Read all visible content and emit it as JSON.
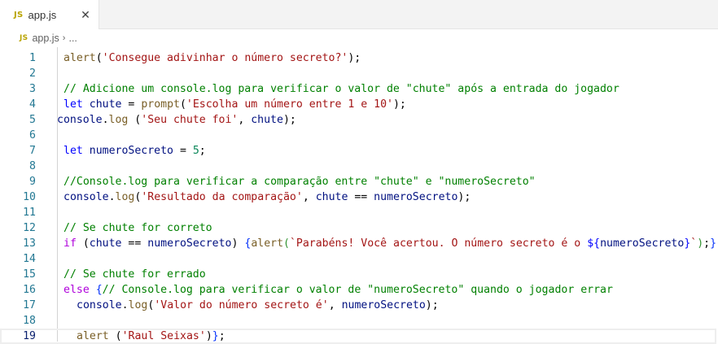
{
  "tab": {
    "badge": "JS",
    "title": "app.js",
    "close_icon": "close-icon"
  },
  "breadcrumb": {
    "badge": "JS",
    "file": "app.js",
    "chevron": "›",
    "ellipsis": "..."
  },
  "colors": {
    "line_number": "#237893",
    "keyword": "#0000ff",
    "control": "#af00db",
    "function": "#795e26",
    "variable": "#001080",
    "string": "#a31515",
    "number": "#098658",
    "comment": "#008000"
  },
  "editor": {
    "current_line": 19,
    "lines": [
      {
        "n": "1",
        "indent": 1,
        "tokens": [
          [
            "fn",
            "alert"
          ],
          [
            "plain",
            "("
          ],
          [
            "str",
            "'Consegue adivinhar o número secreto?'"
          ],
          [
            "plain",
            ");"
          ]
        ]
      },
      {
        "n": "2",
        "indent": 1,
        "tokens": []
      },
      {
        "n": "3",
        "indent": 1,
        "tokens": [
          [
            "cmt",
            "// Adicione um console.log para verificar o valor de \"chute\" após a entrada do jogador"
          ]
        ]
      },
      {
        "n": "4",
        "indent": 1,
        "tokens": [
          [
            "kw",
            "let"
          ],
          [
            "plain",
            " "
          ],
          [
            "var",
            "chute"
          ],
          [
            "plain",
            " = "
          ],
          [
            "fn",
            "prompt"
          ],
          [
            "plain",
            "("
          ],
          [
            "str",
            "'Escolha um número entre 1 e 10'"
          ],
          [
            "plain",
            ");"
          ]
        ]
      },
      {
        "n": "5",
        "indent": 0,
        "tokens": [
          [
            "var",
            "console"
          ],
          [
            "plain",
            "."
          ],
          [
            "fn",
            "log"
          ],
          [
            "plain",
            " ("
          ],
          [
            "str",
            "'Seu chute foi'"
          ],
          [
            "plain",
            ", "
          ],
          [
            "var",
            "chute"
          ],
          [
            "plain",
            ");"
          ]
        ]
      },
      {
        "n": "6",
        "indent": 1,
        "tokens": []
      },
      {
        "n": "7",
        "indent": 1,
        "tokens": [
          [
            "kw",
            "let"
          ],
          [
            "plain",
            " "
          ],
          [
            "var",
            "numeroSecreto"
          ],
          [
            "plain",
            " = "
          ],
          [
            "num",
            "5"
          ],
          [
            "plain",
            ";"
          ]
        ]
      },
      {
        "n": "8",
        "indent": 1,
        "tokens": []
      },
      {
        "n": "9",
        "indent": 1,
        "tokens": [
          [
            "cmt",
            "//Console.log para verificar a comparação entre \"chute\" e \"numeroSecreto\""
          ]
        ]
      },
      {
        "n": "10",
        "indent": 1,
        "tokens": [
          [
            "var",
            "console"
          ],
          [
            "plain",
            "."
          ],
          [
            "fn",
            "log"
          ],
          [
            "plain",
            "("
          ],
          [
            "str",
            "'Resultado da comparação'"
          ],
          [
            "plain",
            ", "
          ],
          [
            "var",
            "chute"
          ],
          [
            "plain",
            " == "
          ],
          [
            "var",
            "numeroSecreto"
          ],
          [
            "plain",
            ");"
          ]
        ]
      },
      {
        "n": "11",
        "indent": 1,
        "tokens": []
      },
      {
        "n": "12",
        "indent": 1,
        "tokens": [
          [
            "cmt",
            "// Se chute for correto"
          ]
        ]
      },
      {
        "n": "13",
        "indent": 1,
        "tokens": [
          [
            "kw2",
            "if"
          ],
          [
            "plain",
            " ("
          ],
          [
            "var",
            "chute"
          ],
          [
            "plain",
            " == "
          ],
          [
            "var",
            "numeroSecreto"
          ],
          [
            "plain",
            ") "
          ],
          [
            "br1",
            "{"
          ],
          [
            "fn",
            "alert"
          ],
          [
            "br2",
            "("
          ],
          [
            "str",
            "`Parabéns! Você acertou. O número secreto é o "
          ],
          [
            "kw",
            "${"
          ],
          [
            "var",
            "numeroSecreto"
          ],
          [
            "kw",
            "}"
          ],
          [
            "str",
            "`"
          ],
          [
            "br2",
            ")"
          ],
          [
            "plain",
            ";"
          ],
          [
            "br1",
            "}"
          ]
        ]
      },
      {
        "n": "14",
        "indent": 1,
        "tokens": []
      },
      {
        "n": "15",
        "indent": 1,
        "tokens": [
          [
            "cmt",
            "// Se chute for errado"
          ]
        ]
      },
      {
        "n": "16",
        "indent": 1,
        "tokens": [
          [
            "kw2",
            "else"
          ],
          [
            "plain",
            " "
          ],
          [
            "br1",
            "{"
          ],
          [
            "cmt",
            "// Console.log para verificar o valor de \"numeroSecreto\" quando o jogador errar"
          ]
        ]
      },
      {
        "n": "17",
        "indent": 3,
        "tokens": [
          [
            "var",
            "console"
          ],
          [
            "plain",
            "."
          ],
          [
            "fn",
            "log"
          ],
          [
            "plain",
            "("
          ],
          [
            "str",
            "'Valor do número secreto é'"
          ],
          [
            "plain",
            ", "
          ],
          [
            "var",
            "numeroSecreto"
          ],
          [
            "plain",
            ");"
          ]
        ]
      },
      {
        "n": "18",
        "indent": 1,
        "tokens": []
      },
      {
        "n": "19",
        "indent": 3,
        "tokens": [
          [
            "fn",
            "alert"
          ],
          [
            "plain",
            " ("
          ],
          [
            "str",
            "'Raul Seixas'"
          ],
          [
            "plain",
            ")"
          ],
          [
            "br1",
            "}"
          ],
          [
            "plain",
            ";"
          ]
        ]
      }
    ]
  }
}
